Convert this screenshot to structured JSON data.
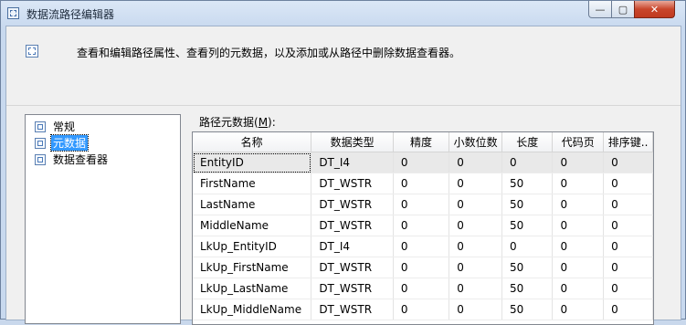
{
  "window": {
    "title": "数据流路径编辑器",
    "close_glyph": "✕",
    "max_glyph": "▢",
    "min_glyph": "—"
  },
  "header": {
    "description": "查看和编辑路径属性、查看列的元数据，以及添加或从路径中删除数据查看器。"
  },
  "tree": {
    "items": [
      {
        "label": "常规"
      },
      {
        "label": "元数据",
        "selected": true
      },
      {
        "label": "数据查看器"
      }
    ]
  },
  "metadata": {
    "label_prefix": "路径元数据(",
    "label_key": "M",
    "label_suffix": "):",
    "columns": [
      "名称",
      "数据类型",
      "精度",
      "小数位数",
      "长度",
      "代码页",
      "排序键.."
    ],
    "rows": [
      [
        "EntityID",
        "DT_I4",
        "0",
        "0",
        "0",
        "0",
        "0"
      ],
      [
        "FirstName",
        "DT_WSTR",
        "0",
        "0",
        "50",
        "0",
        "0"
      ],
      [
        "LastName",
        "DT_WSTR",
        "0",
        "0",
        "50",
        "0",
        "0"
      ],
      [
        "MiddleName",
        "DT_WSTR",
        "0",
        "0",
        "50",
        "0",
        "0"
      ],
      [
        "LkUp_EntityID",
        "DT_I4",
        "0",
        "0",
        "0",
        "0",
        "0"
      ],
      [
        "LkUp_FirstName",
        "DT_WSTR",
        "0",
        "0",
        "50",
        "0",
        "0"
      ],
      [
        "LkUp_LastName",
        "DT_WSTR",
        "0",
        "0",
        "50",
        "0",
        "0"
      ],
      [
        "LkUp_MiddleName",
        "DT_WSTR",
        "0",
        "0",
        "50",
        "0",
        "0"
      ]
    ]
  }
}
